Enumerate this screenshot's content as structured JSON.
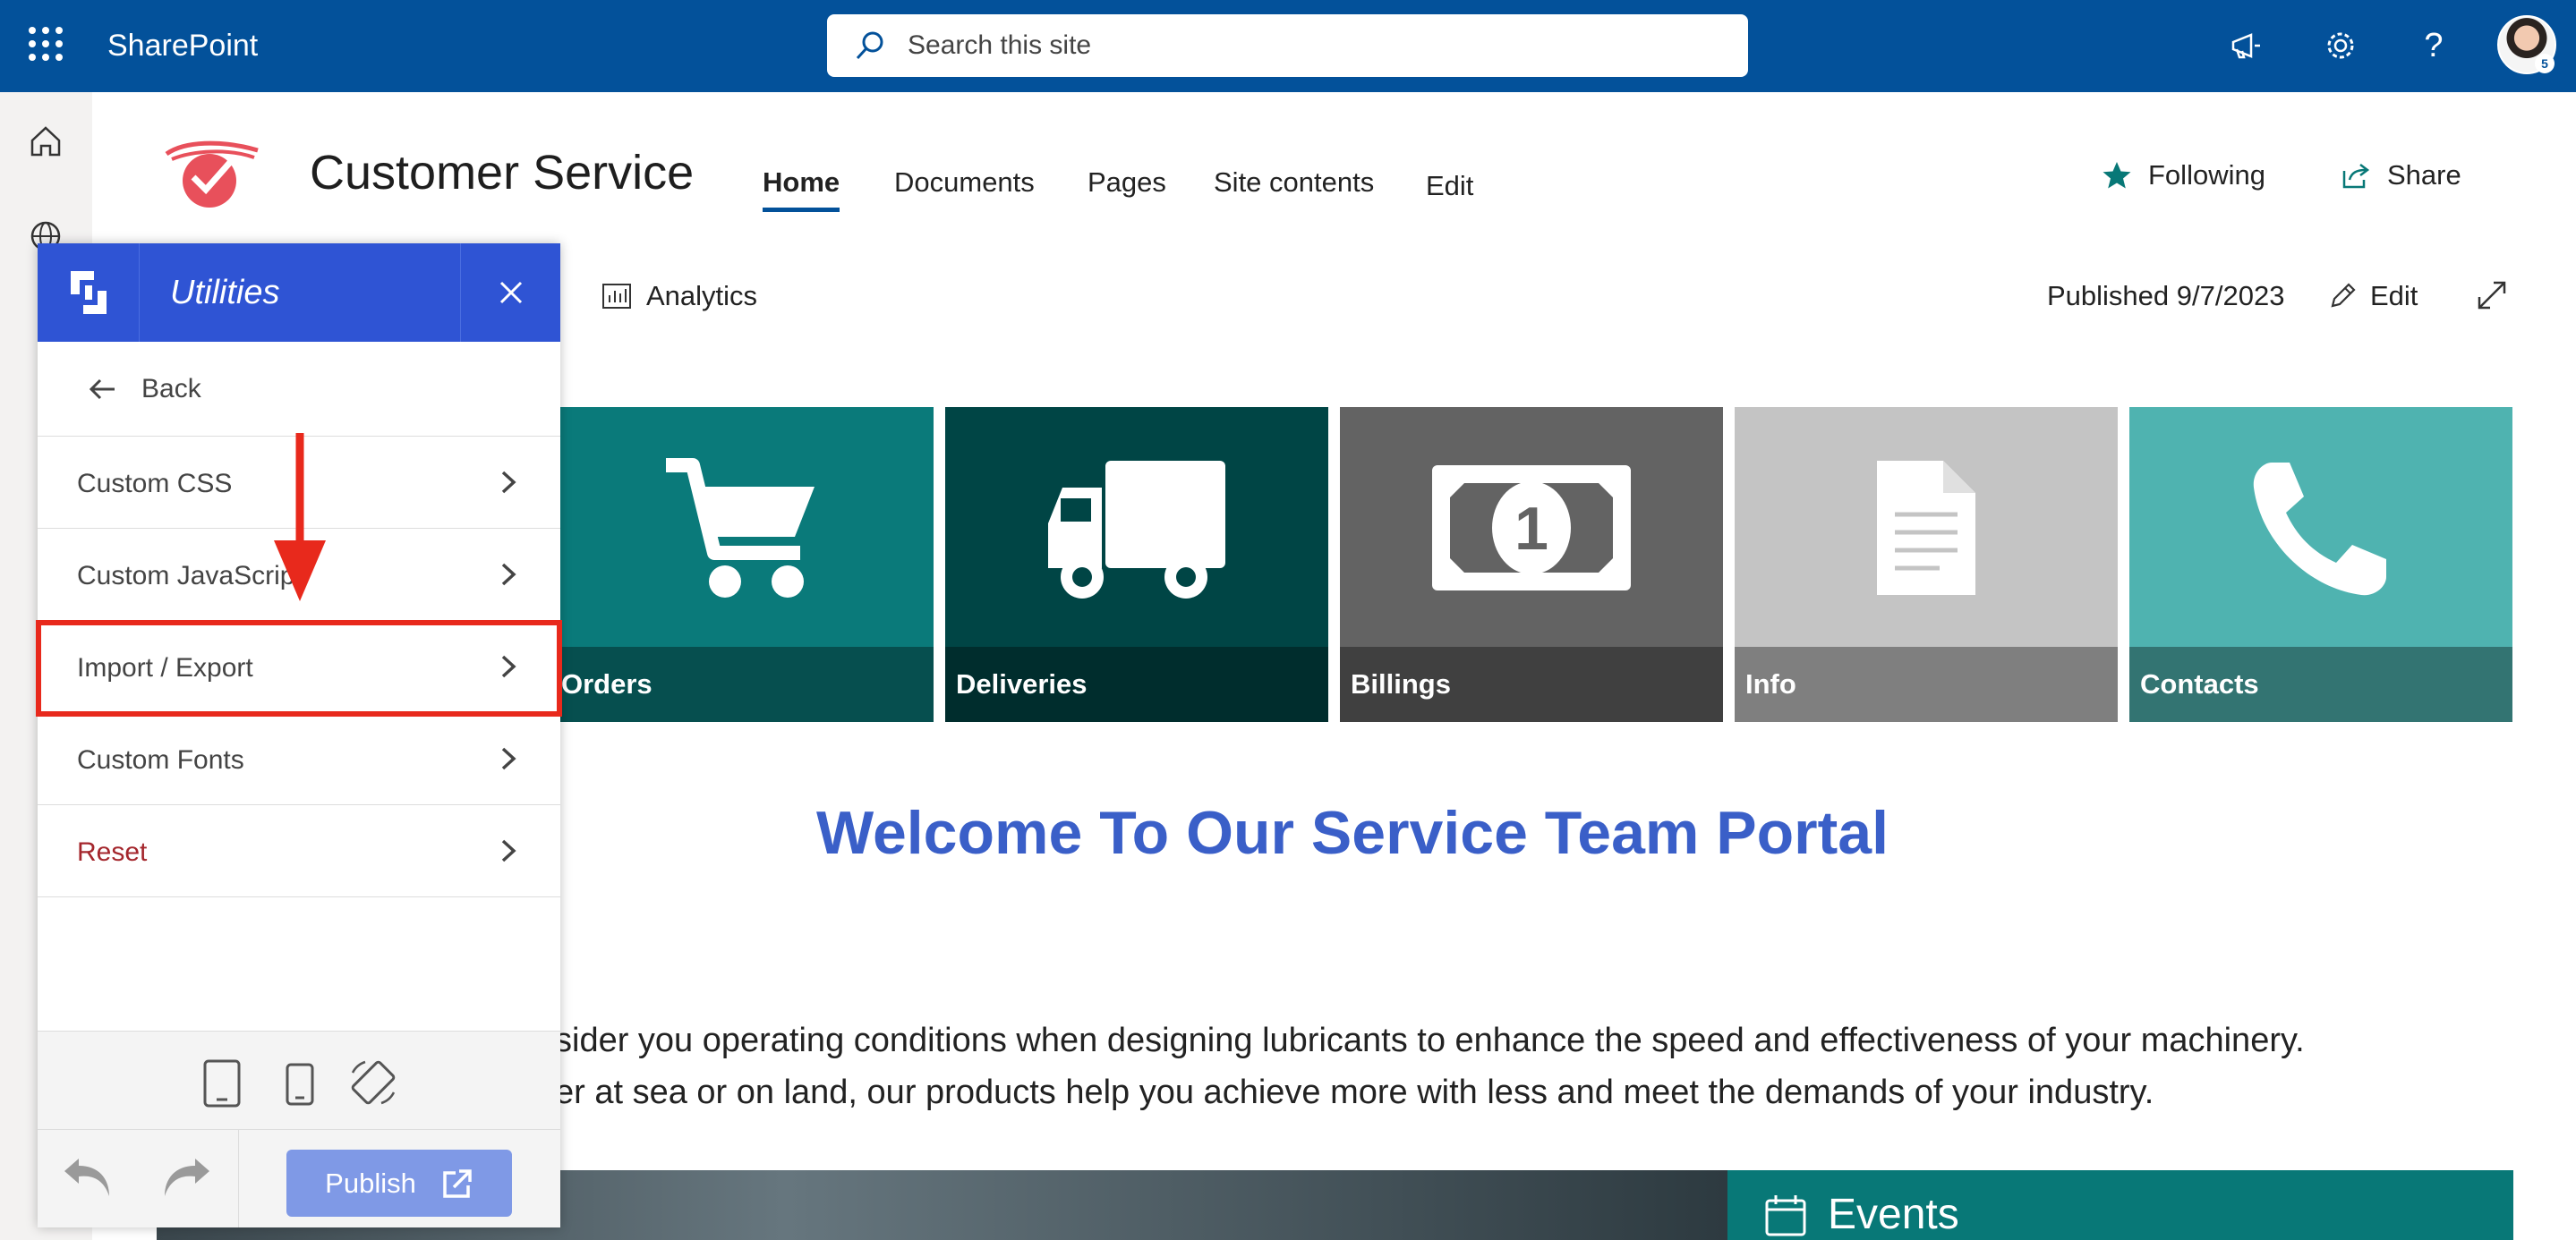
{
  "suitebar": {
    "app_name": "SharePoint",
    "search_placeholder": "Search this site",
    "avatar_badge": "5"
  },
  "site": {
    "title": "Customer Service",
    "nav": [
      "Home",
      "Documents",
      "Pages",
      "Site contents",
      "Edit"
    ],
    "following_label": "Following",
    "share_label": "Share"
  },
  "commandbar": {
    "analytics_label": "Analytics",
    "published": "Published 9/7/2023",
    "edit_label": "Edit"
  },
  "tiles": [
    {
      "label": "Orders",
      "color": "#0a7a7a",
      "icon": "cart-icon"
    },
    {
      "label": "Deliveries",
      "color": "#004545",
      "icon": "truck-icon"
    },
    {
      "label": "Billings",
      "color": "#636363",
      "icon": "money-icon"
    },
    {
      "label": "Info",
      "color": "#c4c4c4",
      "icon": "document-icon"
    },
    {
      "label": "Contacts",
      "color": "#4fb3b0",
      "icon": "phone-icon"
    }
  ],
  "content": {
    "welcome": "Welcome To Our Service Team Portal",
    "para_line1": "sider you operating conditions when designing lubricants to enhance the speed and effectiveness of your machinery.",
    "para_line2": "er at sea or on land, our products help you achieve more with less and meet the demands of your industry.",
    "events_title": "Events"
  },
  "panel": {
    "title": "Utilities",
    "back_label": "Back",
    "items": [
      "Custom CSS",
      "Custom JavaScript",
      "Import / Export",
      "Custom Fonts",
      "Reset"
    ],
    "publish_label": "Publish"
  },
  "colors": {
    "suitebar": "#03519a",
    "panel_header": "#2f54d4",
    "welcome": "#3a5fc8",
    "highlight": "#e8291c",
    "reset": "#a4262c"
  }
}
